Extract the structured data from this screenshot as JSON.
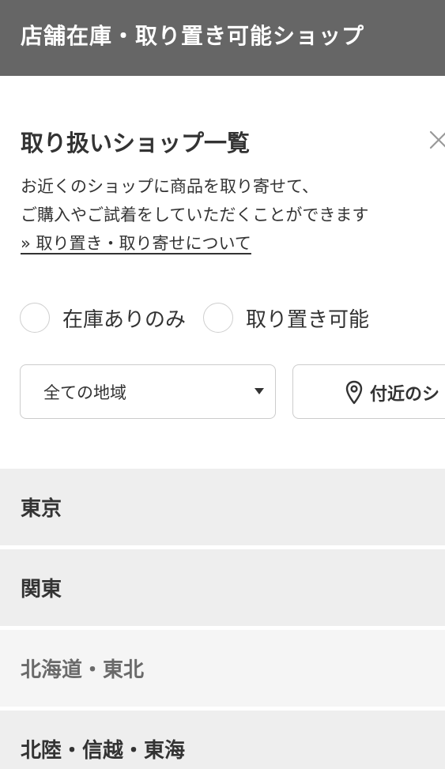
{
  "header": {
    "title": "店舗在庫・取り置き可能ショップ"
  },
  "panel": {
    "title": "取り扱いショップ一覧",
    "description_lines": [
      "お近くのショップに商品を取り寄せて、",
      "ご購入やご試着をしていただくことができます"
    ],
    "link_text": "» 取り置き・取り寄せについて"
  },
  "filters": {
    "in_stock_only": {
      "label": "在庫ありのみ",
      "checked": false
    },
    "reservable": {
      "label": "取り置き可能",
      "checked": false
    }
  },
  "region_select": {
    "selected": "全ての地域"
  },
  "nearby_button": {
    "label": "付近のシ"
  },
  "regions": [
    {
      "label": "東京"
    },
    {
      "label": "関東"
    },
    {
      "label": "北海道・東北"
    },
    {
      "label": "北陸・信越・東海"
    }
  ],
  "colors": {
    "header_bg": "#666666",
    "text": "#333333",
    "region_bg": "#eeeeee",
    "region_bg_muted": "#f5f5f5",
    "region_text_muted": "#6a6a6a",
    "border": "#cccccc"
  },
  "icons": {
    "close": "close-icon",
    "pin": "location-pin-icon",
    "dropdown": "chevron-down-icon"
  }
}
